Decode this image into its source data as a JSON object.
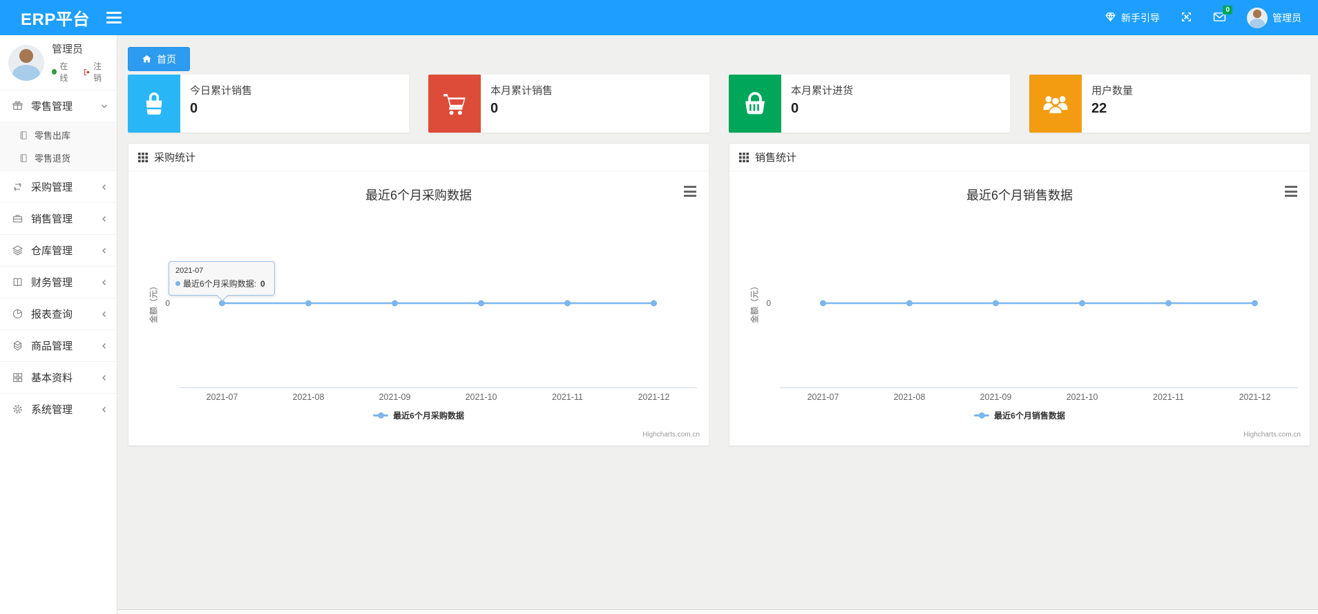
{
  "header": {
    "logo": "ERP平台",
    "guide_label": "新手引导",
    "mail_badge": "0",
    "user_name": "管理员",
    "bar_color": "#1e9fff"
  },
  "sidebar": {
    "user": {
      "name": "管理员",
      "status": "在线",
      "logout": "注销"
    },
    "items": [
      {
        "label": "零售管理",
        "icon": "gift-icon",
        "state": "expanded",
        "children": [
          {
            "label": "零售出库",
            "icon": "journal-icon"
          },
          {
            "label": "零售退货",
            "icon": "journal-icon"
          }
        ]
      },
      {
        "label": "采购管理",
        "icon": "repeat-icon"
      },
      {
        "label": "销售管理",
        "icon": "briefcase-icon"
      },
      {
        "label": "仓库管理",
        "icon": "layers-icon"
      },
      {
        "label": "财务管理",
        "icon": "open-book-icon"
      },
      {
        "label": "报表查询",
        "icon": "pie-chart-icon"
      },
      {
        "label": "商品管理",
        "icon": "box-icon"
      },
      {
        "label": "基本资料",
        "icon": "grid-icon"
      },
      {
        "label": "系统管理",
        "icon": "gear-icon"
      }
    ]
  },
  "breadcrumb": {
    "home_tab": "首页"
  },
  "stat_cards": [
    {
      "label": "今日累计销售",
      "value": "0",
      "color": "#29b6f6",
      "icon": "shopping-bag-icon"
    },
    {
      "label": "本月累计销售",
      "value": "0",
      "color": "#dd4b39",
      "icon": "shopping-cart-icon"
    },
    {
      "label": "本月累计进货",
      "value": "0",
      "color": "#00a65a",
      "icon": "basket-icon"
    },
    {
      "label": "用户数量",
      "value": "22",
      "color": "#f39c12",
      "icon": "users-icon"
    }
  ],
  "panels": [
    {
      "header": "采购统计"
    },
    {
      "header": "销售统计"
    }
  ],
  "chart_data": [
    {
      "type": "line",
      "title": "最近6个月采购数据",
      "categories": [
        "2021-07",
        "2021-08",
        "2021-09",
        "2021-10",
        "2021-11",
        "2021-12"
      ],
      "series": [
        {
          "name": "最近6个月采购数据",
          "values": [
            0,
            0,
            0,
            0,
            0,
            0
          ],
          "color": "#7cb5ec"
        }
      ],
      "xlabel": "",
      "ylabel": "金额（元）",
      "ytick": "0",
      "ylim": [
        0,
        1
      ],
      "grid": false,
      "legend_position": "bottom",
      "credit": "Highcharts.com.cn",
      "tooltip": {
        "title": "2021-07",
        "label": "最近6个月采购数据:",
        "value": "0",
        "point_index": 0
      }
    },
    {
      "type": "line",
      "title": "最近6个月销售数据",
      "categories": [
        "2021-07",
        "2021-08",
        "2021-09",
        "2021-10",
        "2021-11",
        "2021-12"
      ],
      "series": [
        {
          "name": "最近6个月销售数据",
          "values": [
            0,
            0,
            0,
            0,
            0,
            0
          ],
          "color": "#7cb5ec"
        }
      ],
      "xlabel": "",
      "ylabel": "金额（元）",
      "ytick": "0",
      "ylim": [
        0,
        1
      ],
      "grid": false,
      "legend_position": "bottom",
      "credit": "Highcharts.com.cn"
    }
  ]
}
